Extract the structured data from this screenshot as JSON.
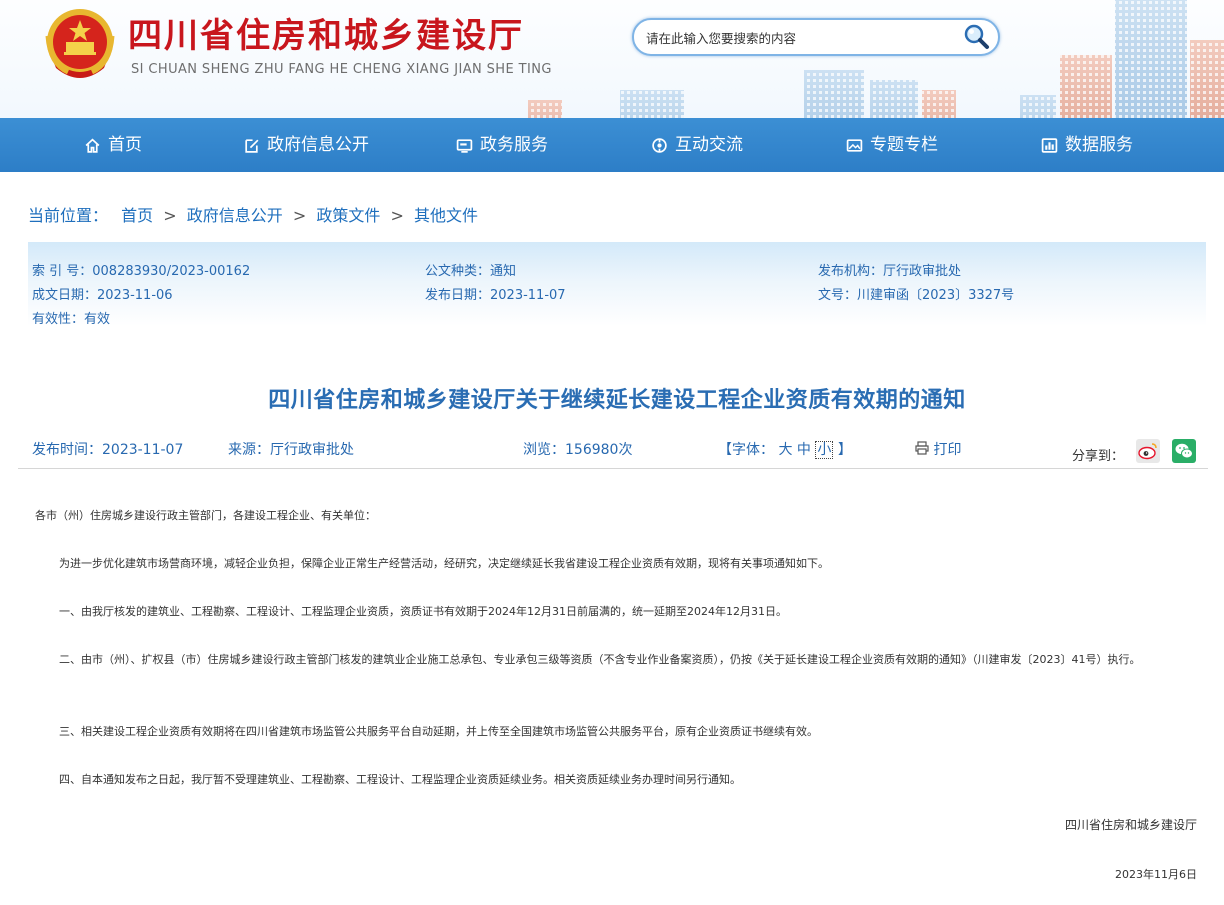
{
  "header": {
    "site_title": "四川省住房和城乡建设厅",
    "site_pinyin": "SI CHUAN SHENG ZHU FANG HE CHENG XIANG JIAN SHE TING",
    "search_placeholder": "请在此输入您要搜索的内容"
  },
  "nav": {
    "items": [
      {
        "label": "首页",
        "icon": "home-icon"
      },
      {
        "label": "政府信息公开",
        "icon": "edit-icon"
      },
      {
        "label": "政务服务",
        "icon": "monitor-icon"
      },
      {
        "label": "互动交流",
        "icon": "interact-icon"
      },
      {
        "label": "专题专栏",
        "icon": "image-icon"
      },
      {
        "label": "数据服务",
        "icon": "chart-icon"
      }
    ]
  },
  "breadcrumb": {
    "prefix": "当前位置：",
    "items": [
      "首页",
      "政府信息公开",
      "政策文件",
      "其他文件"
    ],
    "separator": ">"
  },
  "meta": {
    "index_no": "索 引 号：008283930/2023-00162",
    "doc_category": "公文种类：通知",
    "publisher": "发布机构：厅行政审批处",
    "written_date": "成文日期：2023-11-06",
    "publish_date": "发布日期：2023-11-07",
    "doc_number": "文号：川建审函〔2023〕3327号",
    "validity": "有效性：有效"
  },
  "article": {
    "title": "四川省住房和城乡建设厅关于继续延长建设工程企业资质有效期的通知",
    "info": {
      "published": "发布时间：2023-11-07",
      "source": "来源：厅行政审批处",
      "views": "浏览：156980次",
      "font_open": "【字体：",
      "font_large": "大",
      "font_medium": "中",
      "font_small": "小",
      "font_close": "】",
      "print_label": "打印",
      "share_label": "分享到："
    },
    "salutation": "各市（州）住房城乡建设行政主管部门，各建设工程企业、有关单位：",
    "paragraphs": [
      "为进一步优化建筑市场营商环境，减轻企业负担，保障企业正常生产经营活动，经研究，决定继续延长我省建设工程企业资质有效期，现将有关事项通知如下。",
      "一、由我厅核发的建筑业、工程勘察、工程设计、工程监理企业资质，资质证书有效期于2024年12月31日前届满的，统一延期至2024年12月31日。",
      "二、由市（州）、扩权县（市）住房城乡建设行政主管部门核发的建筑业企业施工总承包、专业承包三级等资质（不含专业作业备案资质），仍按《关于延长建设工程企业资质有效期的通知》（川建审发〔2023〕41号）执行。",
      "三、相关建设工程企业资质有效期将在四川省建筑市场监管公共服务平台自动延期，并上传至全国建筑市场监管公共服务平台，原有企业资质证书继续有效。",
      "四、自本通知发布之日起，我厅暂不受理建筑业、工程勘察、工程设计、工程监理企业资质延续业务。相关资质延续业务办理时间另行通知。"
    ],
    "signature": "四川省住房和城乡建设厅",
    "date": "2023年11月6日"
  },
  "colors": {
    "title_red": "#c8161d",
    "nav_blue": "#2d7ec7",
    "link_blue": "#1f6fbd",
    "meta_blue": "#2869b0",
    "article_title_blue": "#2a6db3"
  }
}
